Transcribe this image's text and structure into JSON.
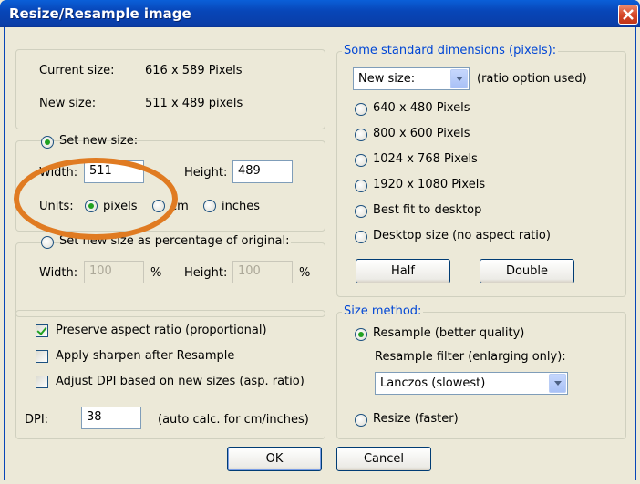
{
  "window": {
    "title": "Resize/Resample image"
  },
  "info": {
    "current_label": "Current size:",
    "current_value": "616  x  589  Pixels",
    "new_label": "New size:",
    "new_value": "511  x  489  pixels"
  },
  "set_new_size": {
    "label": "Set new size:",
    "width_label": "Width:",
    "width_value": "511",
    "height_label": "Height:",
    "height_value": "489",
    "units_label": "Units:",
    "unit_pixels": "pixels",
    "unit_cm": "cm",
    "unit_inches": "inches"
  },
  "percentage": {
    "label": "Set new size as percentage of original:",
    "width_label": "Width:",
    "width_value": "100",
    "percent1": "%",
    "height_label": "Height:",
    "height_value": "100",
    "percent2": "%"
  },
  "options": {
    "preserve": "Preserve aspect ratio (proportional)",
    "sharpen": "Apply sharpen after Resample",
    "dpi_adjust": "Adjust DPI based on new sizes (asp. ratio)",
    "dpi_label": "DPI:",
    "dpi_value": "38",
    "dpi_note": "(auto calc. for cm/inches)"
  },
  "standard": {
    "legend": "Some standard dimensions (pixels):",
    "combo_value": "New size:",
    "ratio_note": "(ratio option used)",
    "opt_640": "640 x 480 Pixels",
    "opt_800": "800 x 600 Pixels",
    "opt_1024": "1024 x 768 Pixels",
    "opt_1920": "1920 x 1080 Pixels",
    "opt_bestfit": "Best fit to desktop",
    "opt_desktop": "Desktop size (no aspect ratio)",
    "half": "Half",
    "double": "Double"
  },
  "method": {
    "legend": "Size method:",
    "resample": "Resample (better quality)",
    "filter_label": "Resample filter (enlarging only):",
    "filter_value": "Lanczos (slowest)",
    "resize": "Resize (faster)"
  },
  "buttons": {
    "ok": "OK",
    "cancel": "Cancel"
  },
  "annotation": {
    "color": "#e07b22"
  }
}
